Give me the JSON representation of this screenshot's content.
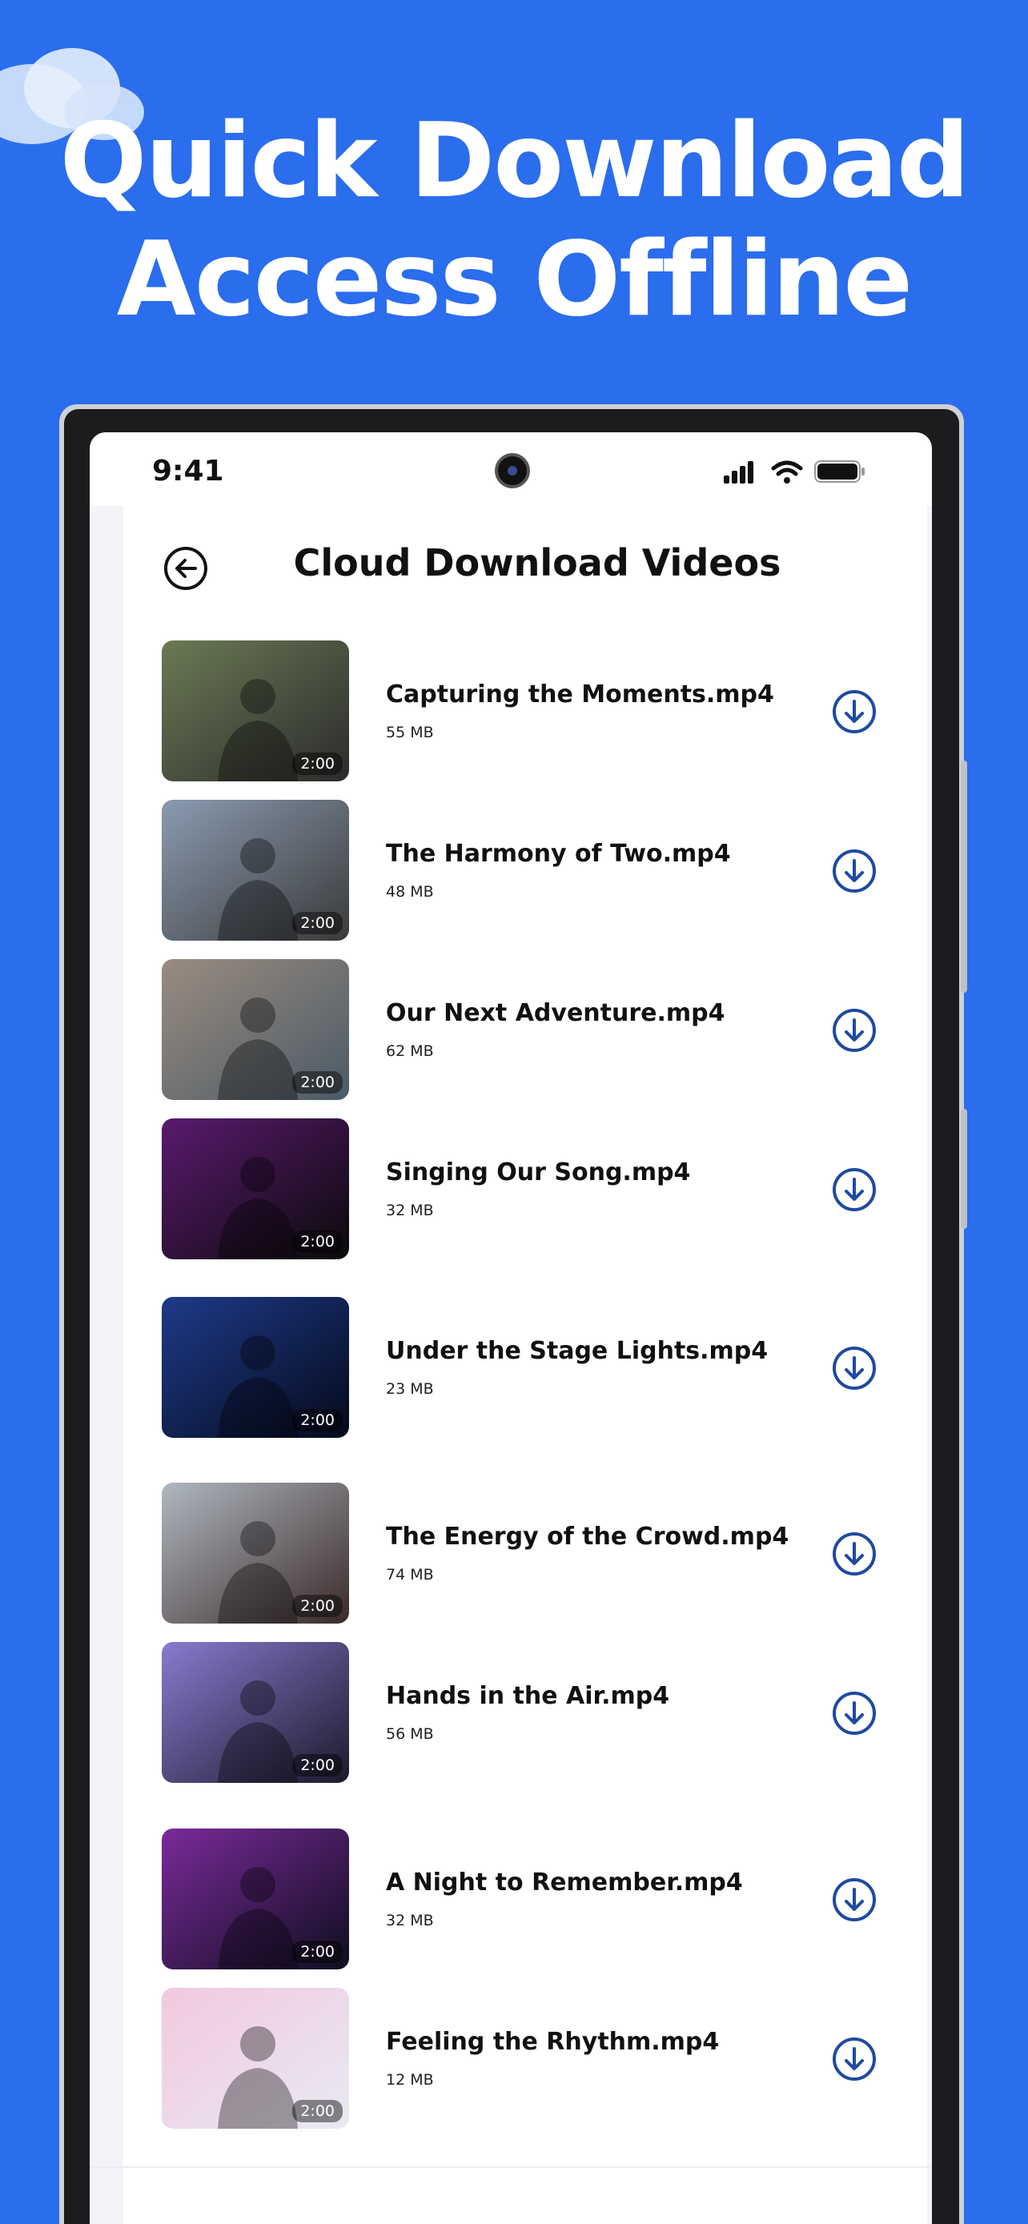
{
  "headline": {
    "line1": "Quick Download",
    "line2": "Access Offline"
  },
  "status_bar": {
    "time": "9:41",
    "icons": [
      "signal-icon",
      "wifi-icon",
      "battery-icon"
    ]
  },
  "header": {
    "back_icon": "back-arrow-icon",
    "title": "Cloud Download Videos"
  },
  "videos": [
    {
      "title": "Capturing the Moments.mp4",
      "size": "55 MB",
      "duration": "2:00",
      "thumb_colors": [
        "#6b7a55",
        "#2b2b2b"
      ]
    },
    {
      "title": "The Harmony of Two.mp4",
      "size": "48 MB",
      "duration": "2:00",
      "thumb_colors": [
        "#8a9bb0",
        "#3a3a3a"
      ]
    },
    {
      "title": "Our Next Adventure.mp4",
      "size": "62 MB",
      "duration": "2:00",
      "thumb_colors": [
        "#9a8c80",
        "#4b5a66"
      ]
    },
    {
      "title": "Singing Our Song.mp4",
      "size": "32 MB",
      "duration": "2:00",
      "thumb_colors": [
        "#5a1a6e",
        "#0a0a0a"
      ]
    },
    {
      "title": "Under the Stage Lights.mp4",
      "size": "23 MB",
      "duration": "2:00",
      "thumb_colors": [
        "#1e3a8a",
        "#050a1a"
      ]
    },
    {
      "title": "The Energy of the Crowd.mp4",
      "size": "74 MB",
      "duration": "2:00",
      "thumb_colors": [
        "#b0b8c0",
        "#3a2a2a"
      ]
    },
    {
      "title": "Hands in the Air.mp4",
      "size": "56 MB",
      "duration": "2:00",
      "thumb_colors": [
        "#8a7ad0",
        "#1a1a2a"
      ]
    },
    {
      "title": "A Night to Remember.mp4",
      "size": "32 MB",
      "duration": "2:00",
      "thumb_colors": [
        "#7a2a9a",
        "#0e0e1e"
      ]
    },
    {
      "title": "Feeling the Rhythm.mp4",
      "size": "12 MB",
      "duration": "2:00",
      "thumb_colors": [
        "#f2c8e0",
        "#e8eaf2"
      ]
    }
  ],
  "colors": {
    "background": "#2a6ded",
    "accent_icon": "#1f4aa0"
  }
}
